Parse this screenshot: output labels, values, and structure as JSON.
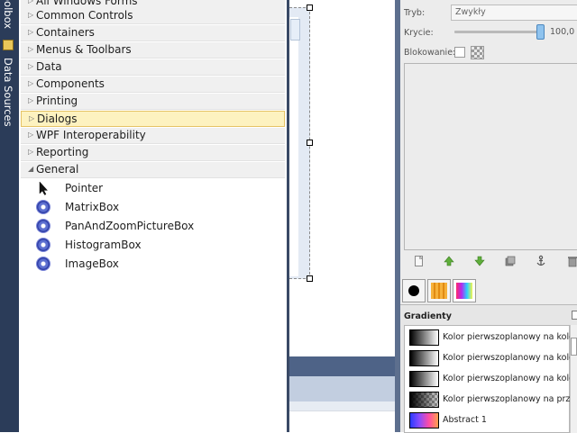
{
  "sidebar": {
    "toolbox_tab": "oolbox",
    "data_sources_tab": "Data Sources"
  },
  "toolbox": {
    "categories": [
      {
        "label": "All Windows Forms",
        "expanded": false
      },
      {
        "label": "Common Controls",
        "expanded": false
      },
      {
        "label": "Containers",
        "expanded": false
      },
      {
        "label": "Menus & Toolbars",
        "expanded": false
      },
      {
        "label": "Data",
        "expanded": false
      },
      {
        "label": "Components",
        "expanded": false
      },
      {
        "label": "Printing",
        "expanded": false
      },
      {
        "label": "Dialogs",
        "expanded": false,
        "selected": true
      },
      {
        "label": "WPF Interoperability",
        "expanded": false
      },
      {
        "label": "Reporting",
        "expanded": false
      },
      {
        "label": "General",
        "expanded": true
      }
    ],
    "arrows": {
      "collapsed": "▷",
      "expanded": "◢"
    },
    "general_items": [
      {
        "label": "Pointer",
        "icon": "pointer-icon"
      },
      {
        "label": "MatrixBox",
        "icon": "gear-icon"
      },
      {
        "label": "PanAndZoomPictureBox",
        "icon": "gear-icon"
      },
      {
        "label": "HistogramBox",
        "icon": "gear-icon"
      },
      {
        "label": "ImageBox",
        "icon": "gear-icon"
      }
    ]
  },
  "layers": {
    "mode_label": "Tryb:",
    "mode_value": "Zwykły",
    "opacity_label": "Krycie:",
    "opacity_value": "100,0",
    "lock_label": "Blokowanie:",
    "toolbar_icons": [
      "new-layer-icon",
      "raise-layer-icon",
      "lower-layer-icon",
      "duplicate-layer-icon",
      "anchor-layer-icon",
      "delete-layer-icon"
    ]
  },
  "dock_tabs": [
    "brushes-tab",
    "patterns-tab",
    "gradients-tab"
  ],
  "gradients": {
    "title": "Gradienty",
    "items": [
      "Kolor pierwszoplanowy na kolor",
      "Kolor pierwszoplanowy na kolor",
      "Kolor pierwszoplanowy na kolor",
      "Kolor pierwszoplanowy na przez",
      "Abstract 1"
    ]
  }
}
